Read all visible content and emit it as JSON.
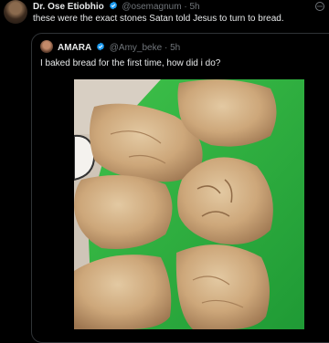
{
  "tweet": {
    "author_name": "Dr. Ose Etiobhio",
    "handle": "@osemagnum",
    "separator": "·",
    "time": "5h",
    "text": "these were the exact stones Satan told Jesus to turn to bread."
  },
  "quote": {
    "author_name": "AMARA",
    "handle": "@Amy_beke",
    "separator": "·",
    "time": "5h",
    "text": "I baked bread for the first time, how did i do?"
  },
  "icons": {
    "verified": "verified-badge-icon",
    "more": "more-options-icon"
  },
  "colors": {
    "background": "#000000",
    "text": "#e7e9ea",
    "muted": "#71767b",
    "verified": "#1d9bf0",
    "border": "#2f3336"
  }
}
